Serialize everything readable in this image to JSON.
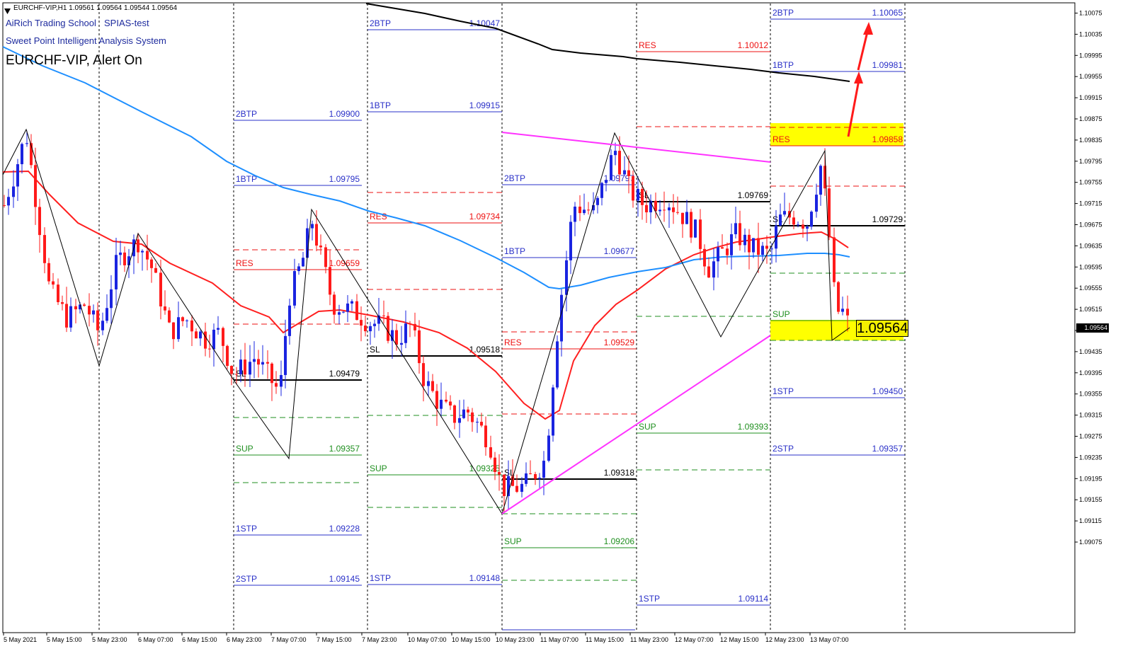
{
  "header": {
    "symbol_line": "EURCHF-VIP,H1  1.09561 1.09564 1.09544 1.09564",
    "school": "AiRich Trading School",
    "test": "SPIAS-test",
    "system": "Sweet Point Intelligent Analysis System",
    "alert": "EURCHF-VIP, Alert On"
  },
  "current_price": "1.09564",
  "price_tag": "1.09564",
  "colors": {
    "bull": "#1a24e0",
    "bear": "#ff1a1a",
    "ema": "#ff2020",
    "ma200": "#1e8fff",
    "ma_long": "#000000",
    "trend": "#ff33ff",
    "btp": "#2a30c8",
    "res": "#ee1111",
    "sup": "#1f8f1f",
    "highlight": "#ffff00",
    "arrow": "#ff1a1a"
  },
  "chart_data": {
    "type": "candlestick",
    "instrument": "EURCHF-VIP",
    "timeframe": "H1",
    "ohlc_last": {
      "open": 1.09561,
      "high": 1.09564,
      "low": 1.09544,
      "close": 1.09564
    },
    "ylim": [
      1.09062,
      1.10113
    ],
    "y_ticks": [
      "1.10075",
      "1.10035",
      "1.09995",
      "1.09955",
      "1.09915",
      "1.09875",
      "1.09835",
      "1.09795",
      "1.09755",
      "1.09715",
      "1.09675",
      "1.09635",
      "1.09595",
      "1.09555",
      "1.09515",
      "1.09475",
      "1.09435",
      "1.09395",
      "1.09355",
      "1.09315",
      "1.09275",
      "1.09235",
      "1.09195",
      "1.09155",
      "1.09115",
      "1.09075"
    ],
    "x_ticks": [
      "5 May 2021",
      "5 May 15:00",
      "5 May 23:00",
      "6 May 07:00",
      "6 May 15:00",
      "6 May 23:00",
      "7 May 07:00",
      "7 May 15:00",
      "7 May 23:00",
      "10 May 07:00",
      "10 May 15:00",
      "10 May 23:00",
      "11 May 07:00",
      "11 May 15:00",
      "11 May 23:00",
      "12 May 07:00",
      "12 May 15:00",
      "12 May 23:00",
      "13 May 07:00"
    ],
    "levels": [
      {
        "session": 2,
        "label": "2BTP",
        "value": "1.09900",
        "kind": "btp"
      },
      {
        "session": 2,
        "label": "1BTP",
        "value": "1.09795",
        "kind": "btp"
      },
      {
        "session": 2,
        "label": "RES",
        "value": "1.09659",
        "kind": "res"
      },
      {
        "session": 2,
        "label": "SL",
        "value": "1.09479",
        "kind": "sl"
      },
      {
        "session": 2,
        "label": "SUP",
        "value": "1.09357",
        "kind": "sup"
      },
      {
        "session": 2,
        "label": "1STP",
        "value": "1.09228",
        "kind": "btp"
      },
      {
        "session": 2,
        "label": "2STP",
        "value": "1.09145",
        "kind": "btp"
      },
      {
        "session": 3,
        "label": "2BTP",
        "value": "1.10047",
        "kind": "btp"
      },
      {
        "session": 3,
        "label": "1BTP",
        "value": "1.09915",
        "kind": "btp"
      },
      {
        "session": 3,
        "label": "RES",
        "value": "1.09734",
        "kind": "res"
      },
      {
        "session": 3,
        "label": "SL",
        "value": "1.09518",
        "kind": "sl"
      },
      {
        "session": 3,
        "label": "SUP",
        "value": "1.09325",
        "kind": "sup"
      },
      {
        "session": 3,
        "label": "1STP",
        "value": "1.09148",
        "kind": "btp"
      },
      {
        "session": 4,
        "label": "2BTP",
        "value": "1.09797",
        "kind": "btp"
      },
      {
        "session": 4,
        "label": "1BTP",
        "value": "1.09677",
        "kind": "btp"
      },
      {
        "session": 4,
        "label": "RES",
        "value": "1.09529",
        "kind": "res"
      },
      {
        "session": 4,
        "label": "SL",
        "value": "1.09318",
        "kind": "sl"
      },
      {
        "session": 4,
        "label": "SUP",
        "value": "1.09206",
        "kind": "sup"
      },
      {
        "session": 5,
        "label": "RES",
        "value": "1.10012",
        "kind": "res"
      },
      {
        "session": 5,
        "label": "SL",
        "value": "1.09769",
        "kind": "sl"
      },
      {
        "session": 5,
        "label": "SUP",
        "value": "1.09393",
        "kind": "sup"
      },
      {
        "session": 5,
        "label": "1STP",
        "value": "1.09114",
        "kind": "btp"
      },
      {
        "session": 6,
        "label": "2BTP",
        "value": "1.10065",
        "kind": "btp"
      },
      {
        "session": 6,
        "label": "1BTP",
        "value": "1.09981",
        "kind": "btp"
      },
      {
        "session": 6,
        "label": "RES",
        "value": "1.09858",
        "kind": "res"
      },
      {
        "session": 6,
        "label": "SL",
        "value": "1.09729",
        "kind": "sl"
      },
      {
        "session": 6,
        "label": "SUP",
        "value": "",
        "kind": "sup"
      },
      {
        "session": 6,
        "label": "1STP",
        "value": "1.09450",
        "kind": "btp"
      },
      {
        "session": 6,
        "label": "2STP",
        "value": "1.09357",
        "kind": "btp"
      }
    ]
  }
}
